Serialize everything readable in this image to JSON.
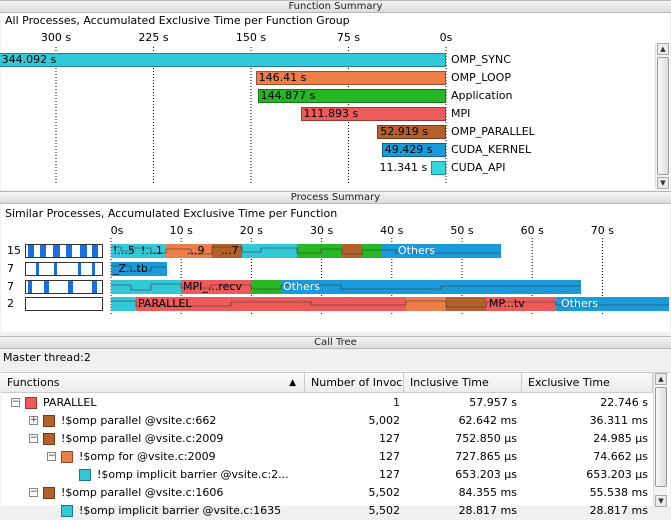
{
  "function_summary": {
    "title": "Function Summary",
    "subtitle": "All Processes, Accumulated Exclusive Time per Function Group",
    "axis_ticks": [
      "300 s",
      "225 s",
      "150 s",
      "75 s",
      "0s"
    ],
    "groups": [
      {
        "name": "OMP_SYNC",
        "value": 344.092,
        "label": "344.092 s",
        "color": "#32c8d8"
      },
      {
        "name": "OMP_LOOP",
        "value": 146.41,
        "label": "146.41 s",
        "color": "#ec7e4a"
      },
      {
        "name": "Application",
        "value": 144.877,
        "label": "144.877 s",
        "color": "#26b626"
      },
      {
        "name": "MPI",
        "value": 111.893,
        "label": "111.893 s",
        "color": "#ec5a5a"
      },
      {
        "name": "OMP_PARALLEL",
        "value": 52.919,
        "label": "52.919 s",
        "color": "#b4602a"
      },
      {
        "name": "CUDA_KERNEL",
        "value": 49.429,
        "label": "49.429 s",
        "color": "#1a9ad8"
      },
      {
        "name": "CUDA_API",
        "value": 11.341,
        "label": "11.341 s",
        "color": "#30d8e0"
      }
    ]
  },
  "process_summary": {
    "title": "Process Summary",
    "subtitle": "Similar Processes, Accumulated Exclusive Time per Function",
    "axis_ticks": [
      "0s",
      "10 s",
      "20 s",
      "30 s",
      "40 s",
      "50 s",
      "60 s",
      "70 s"
    ],
    "rows": [
      {
        "count": "15",
        "labels": [
          "!...5",
          "!...1",
          "...9",
          "...7",
          "Others"
        ]
      },
      {
        "count": "7",
        "labels": [
          "_Z...tb"
        ]
      },
      {
        "count": "7",
        "labels": [
          "MPI_...recv",
          "Others"
        ]
      },
      {
        "count": "2",
        "labels": [
          "PARALLEL",
          "MP...tv",
          "Others"
        ]
      }
    ]
  },
  "call_tree": {
    "title": "Call Tree",
    "master_label": "Master thread:2",
    "columns": [
      "Functions",
      "Number of Invoc",
      "Inclusive Time",
      "Exclusive Time"
    ],
    "rows": [
      {
        "name": "PARALLEL",
        "invocations": "1",
        "inclusive": "57.957 s",
        "exclusive": "22.746 s",
        "color": "#ec5a5a",
        "expander": "−"
      },
      {
        "name": "!$omp parallel @vsite.c:662",
        "invocations": "5,002",
        "inclusive": "62.642 ms",
        "exclusive": "36.311 ms",
        "color": "#b4602a",
        "expander": "+"
      },
      {
        "name": "!$omp parallel @vsite.c:2009",
        "invocations": "127",
        "inclusive": "752.850 µs",
        "exclusive": "24.985 µs",
        "color": "#b4602a",
        "expander": "−"
      },
      {
        "name": "!$omp for @vsite.c:2009",
        "invocations": "127",
        "inclusive": "727.865 µs",
        "exclusive": "74.662 µs",
        "color": "#ec7e4a",
        "expander": "−"
      },
      {
        "name": "!$omp implicit barrier @vsite.c:2...",
        "invocations": "127",
        "inclusive": "653.203 µs",
        "exclusive": "653.203 µs",
        "color": "#32c8d8",
        "expander": ""
      },
      {
        "name": "!$omp parallel @vsite.c:1606",
        "invocations": "5,502",
        "inclusive": "84.355 ms",
        "exclusive": "55.538 ms",
        "color": "#b4602a",
        "expander": "−"
      },
      {
        "name": "!$omp implicit barrier @vsite.c:1635",
        "invocations": "5,502",
        "inclusive": "28.817 ms",
        "exclusive": "28.817 ms",
        "color": "#32c8d8",
        "expander": ""
      }
    ]
  }
}
